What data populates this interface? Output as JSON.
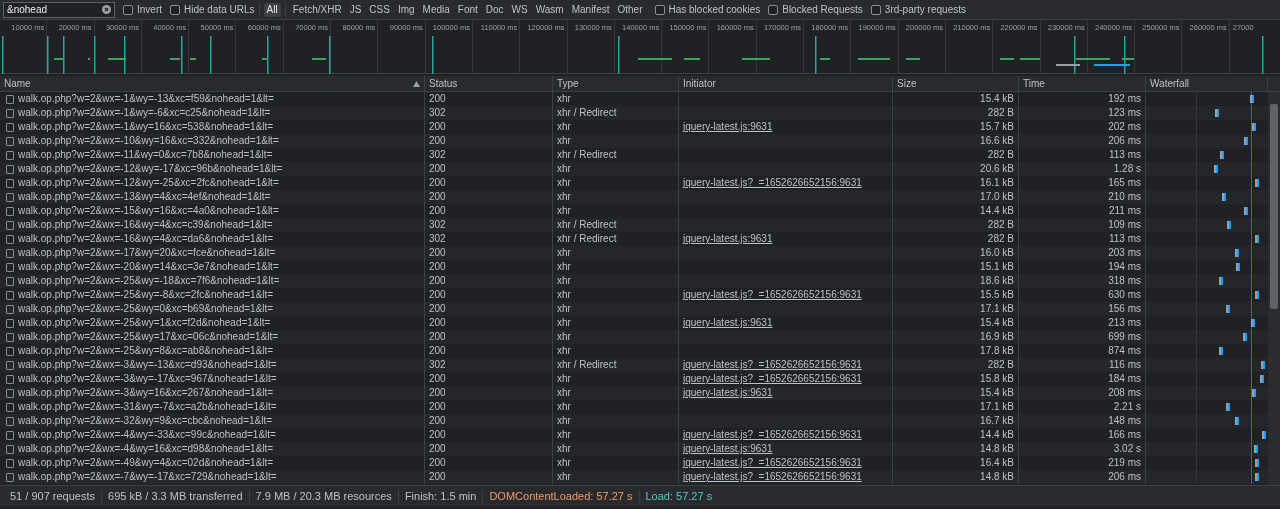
{
  "filter_bar": {
    "search": {
      "value": "&nohead"
    },
    "checkboxes_left": [
      {
        "label": "Invert",
        "checked": false
      },
      {
        "label": "Hide data URLs",
        "checked": false
      }
    ],
    "type_filters": [
      {
        "label": "All",
        "selected": true
      },
      {
        "label": "Fetch/XHR",
        "selected": false
      },
      {
        "label": "JS",
        "selected": false
      },
      {
        "label": "CSS",
        "selected": false
      },
      {
        "label": "Img",
        "selected": false
      },
      {
        "label": "Media",
        "selected": false
      },
      {
        "label": "Font",
        "selected": false
      },
      {
        "label": "Doc",
        "selected": false
      },
      {
        "label": "WS",
        "selected": false
      },
      {
        "label": "Wasm",
        "selected": false
      },
      {
        "label": "Manifest",
        "selected": false
      },
      {
        "label": "Other",
        "selected": false
      }
    ],
    "checkboxes_right": [
      {
        "label": "Has blocked cookies",
        "checked": false
      },
      {
        "label": "Blocked Requests",
        "checked": false
      },
      {
        "label": "3rd-party requests",
        "checked": false
      }
    ]
  },
  "overview": {
    "ticks": [
      "10000 ms",
      "20000 ms",
      "30000 ms",
      "40000 ms",
      "50000 ms",
      "60000 ms",
      "70000 ms",
      "80000 ms",
      "90000 ms",
      "100000 ms",
      "110000 ms",
      "120000 ms",
      "130000 ms",
      "140000 ms",
      "150000 ms",
      "160000 ms",
      "170000 ms",
      "180000 ms",
      "190000 ms",
      "200000 ms",
      "210000 ms",
      "220000 ms",
      "230000 ms",
      "240000 ms",
      "250000 ms",
      "260000 ms",
      "27000"
    ]
  },
  "table": {
    "columns": [
      {
        "label": "Name",
        "sorted": true
      },
      {
        "label": "Status",
        "sorted": false
      },
      {
        "label": "Type",
        "sorted": false
      },
      {
        "label": "Initiator",
        "sorted": false
      },
      {
        "label": "Size",
        "sorted": false
      },
      {
        "label": "Time",
        "sorted": false
      },
      {
        "label": "Waterfall",
        "sorted": false
      }
    ],
    "rows": [
      {
        "name": "walk.op.php?w=2&wx=-1&wy=-13&xc=f59&nohead=1&lt=",
        "status": "200",
        "type": "xhr",
        "initiator": "",
        "size": "15.4 kB",
        "time": "192 ms"
      },
      {
        "name": "walk.op.php?w=2&wx=-1&wy=-6&xc=c25&nohead=1&lt=",
        "status": "302",
        "type": "xhr / Redirect",
        "initiator": "",
        "size": "282 B",
        "time": "123 ms"
      },
      {
        "name": "walk.op.php?w=2&wx=-1&wy=16&xc=538&nohead=1&lt=",
        "status": "200",
        "type": "xhr",
        "initiator": "jquery-latest.js:9631",
        "size": "15.7 kB",
        "time": "202 ms"
      },
      {
        "name": "walk.op.php?w=2&wx=-10&wy=16&xc=332&nohead=1&lt=",
        "status": "200",
        "type": "xhr",
        "initiator": "",
        "size": "16.6 kB",
        "time": "206 ms"
      },
      {
        "name": "walk.op.php?w=2&wx=-11&wy=0&xc=7b8&nohead=1&lt=",
        "status": "302",
        "type": "xhr / Redirect",
        "initiator": "",
        "size": "282 B",
        "time": "113 ms"
      },
      {
        "name": "walk.op.php?w=2&wx=-12&wy=-17&xc=96b&nohead=1&lt=",
        "status": "200",
        "type": "xhr",
        "initiator": "",
        "size": "20.6 kB",
        "time": "1.28 s"
      },
      {
        "name": "walk.op.php?w=2&wx=-12&wy=-25&xc=2fc&nohead=1&lt=",
        "status": "200",
        "type": "xhr",
        "initiator": "jquery-latest.js?_=1652626652156:9631",
        "size": "16.1 kB",
        "time": "165 ms"
      },
      {
        "name": "walk.op.php?w=2&wx=-13&wy=4&xc=4ef&nohead=1&lt=",
        "status": "200",
        "type": "xhr",
        "initiator": "",
        "size": "17.0 kB",
        "time": "210 ms"
      },
      {
        "name": "walk.op.php?w=2&wx=-15&wy=16&xc=4a0&nohead=1&lt=",
        "status": "200",
        "type": "xhr",
        "initiator": "",
        "size": "14.4 kB",
        "time": "211 ms"
      },
      {
        "name": "walk.op.php?w=2&wx=-16&wy=4&xc=c39&nohead=1&lt=",
        "status": "302",
        "type": "xhr / Redirect",
        "initiator": "",
        "size": "282 B",
        "time": "109 ms"
      },
      {
        "name": "walk.op.php?w=2&wx=-16&wy=4&xc=da6&nohead=1&lt=",
        "status": "302",
        "type": "xhr / Redirect",
        "initiator": "jquery-latest.js:9631",
        "size": "282 B",
        "time": "113 ms"
      },
      {
        "name": "walk.op.php?w=2&wx=-17&wy=20&xc=fce&nohead=1&lt=",
        "status": "200",
        "type": "xhr",
        "initiator": "",
        "size": "16.0 kB",
        "time": "203 ms"
      },
      {
        "name": "walk.op.php?w=2&wx=-20&wy=14&xc=3e7&nohead=1&lt=",
        "status": "200",
        "type": "xhr",
        "initiator": "",
        "size": "15.1 kB",
        "time": "194 ms"
      },
      {
        "name": "walk.op.php?w=2&wx=-25&wy=-18&xc=7f6&nohead=1&lt=",
        "status": "200",
        "type": "xhr",
        "initiator": "",
        "size": "18.6 kB",
        "time": "318 ms"
      },
      {
        "name": "walk.op.php?w=2&wx=-25&wy=-8&xc=2fc&nohead=1&lt=",
        "status": "200",
        "type": "xhr",
        "initiator": "jquery-latest.js?_=1652626652156:9631",
        "size": "15.5 kB",
        "time": "630 ms"
      },
      {
        "name": "walk.op.php?w=2&wx=-25&wy=0&xc=b69&nohead=1&lt=",
        "status": "200",
        "type": "xhr",
        "initiator": "",
        "size": "17.1 kB",
        "time": "156 ms"
      },
      {
        "name": "walk.op.php?w=2&wx=-25&wy=1&xc=f2d&nohead=1&lt=",
        "status": "200",
        "type": "xhr",
        "initiator": "jquery-latest.js:9631",
        "size": "15.4 kB",
        "time": "213 ms"
      },
      {
        "name": "walk.op.php?w=2&wx=-25&wy=17&xc=06c&nohead=1&lt=",
        "status": "200",
        "type": "xhr",
        "initiator": "",
        "size": "16.9 kB",
        "time": "699 ms"
      },
      {
        "name": "walk.op.php?w=2&wx=-25&wy=8&xc=ab8&nohead=1&lt=",
        "status": "200",
        "type": "xhr",
        "initiator": "",
        "size": "17.8 kB",
        "time": "874 ms"
      },
      {
        "name": "walk.op.php?w=2&wx=-3&wy=-13&xc=d93&nohead=1&lt=",
        "status": "302",
        "type": "xhr / Redirect",
        "initiator": "jquery-latest.js?_=1652626652156:9631",
        "size": "282 B",
        "time": "116 ms"
      },
      {
        "name": "walk.op.php?w=2&wx=-3&wy=-17&xc=967&nohead=1&lt=",
        "status": "200",
        "type": "xhr",
        "initiator": "jquery-latest.js?_=1652626652156:9631",
        "size": "15.8 kB",
        "time": "184 ms"
      },
      {
        "name": "walk.op.php?w=2&wx=-3&wy=16&xc=267&nohead=1&lt=",
        "status": "200",
        "type": "xhr",
        "initiator": "jquery-latest.js:9631",
        "size": "15.4 kB",
        "time": "208 ms"
      },
      {
        "name": "walk.op.php?w=2&wx=-31&wy=-7&xc=a2b&nohead=1&lt=",
        "status": "200",
        "type": "xhr",
        "initiator": "",
        "size": "17.1 kB",
        "time": "2.21 s"
      },
      {
        "name": "walk.op.php?w=2&wx=-32&wy=9&xc=cbc&nohead=1&lt=",
        "status": "200",
        "type": "xhr",
        "initiator": "",
        "size": "16.7 kB",
        "time": "148 ms"
      },
      {
        "name": "walk.op.php?w=2&wx=-4&wy=-33&xc=99c&nohead=1&lt=",
        "status": "200",
        "type": "xhr",
        "initiator": "jquery-latest.js?_=1652626652156:9631",
        "size": "14.4 kB",
        "time": "166 ms"
      },
      {
        "name": "walk.op.php?w=2&wx=-4&wy=16&xc=d98&nohead=1&lt=",
        "status": "200",
        "type": "xhr",
        "initiator": "jquery-latest.js:9631",
        "size": "14.8 kB",
        "time": "3.02 s"
      },
      {
        "name": "walk.op.php?w=2&wx=-49&wy=4&xc=02d&nohead=1&lt=",
        "status": "200",
        "type": "xhr",
        "initiator": "jquery-latest.js?_=1652626652156:9631",
        "size": "16.4 kB",
        "time": "219 ms"
      },
      {
        "name": "walk.op.php?w=2&wx=-7&wy=-17&xc=729&nohead=1&lt=",
        "status": "200",
        "type": "xhr",
        "initiator": "jquery-latest.js?_=1652626652156:9631",
        "size": "14.8 kB",
        "time": "206 ms"
      }
    ]
  },
  "status_bar": [
    {
      "text": "51 / 907 requests",
      "color": "#bdc1c6"
    },
    {
      "text": "695 kB / 3.3 MB transferred",
      "color": "#bdc1c6"
    },
    {
      "text": "7.9 MB / 20.3 MB resources",
      "color": "#bdc1c6"
    },
    {
      "text": "Finish: 1.5 min",
      "color": "#bdc1c6"
    },
    {
      "text": "DOMContentLoaded: 57.27 s",
      "color": "#f29766"
    },
    {
      "text": "Load: 57.27 s",
      "color": "#4ecdc4"
    }
  ]
}
